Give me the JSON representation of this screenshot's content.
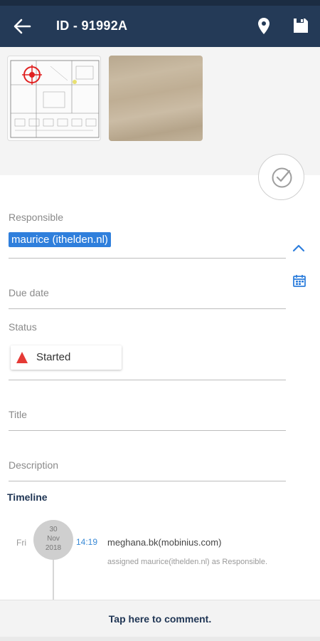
{
  "appbar": {
    "title": "ID - 91992A",
    "back_icon": "arrow-left-icon",
    "location_icon": "map-pin-icon",
    "save_icon": "floppy-disk-icon",
    "background_color": "#243a57"
  },
  "photos": [
    {
      "kind": "floor-plan-thumbnail"
    },
    {
      "kind": "wood-surface-photo"
    }
  ],
  "fields": {
    "responsible_label": "Responsible",
    "responsible_value": "maurice (ithelden.nl)",
    "due_date_label": "Due date",
    "status_label": "Status",
    "status_value": "Started",
    "status_color": "#e53935",
    "title_label": "Title",
    "description_label": "Description"
  },
  "timeline": {
    "heading": "Timeline",
    "entries": [
      {
        "day": "Fri",
        "date_day": "30",
        "date_month": "Nov",
        "date_year": "2018",
        "time": "14:19",
        "user": "meghana.bk(mobinius.com)",
        "action": "assigned maurice(ithelden.nl) as Responsible."
      }
    ]
  },
  "comment_bar": {
    "label": "Tap here to comment."
  },
  "accent_color": "#2f7fdc"
}
